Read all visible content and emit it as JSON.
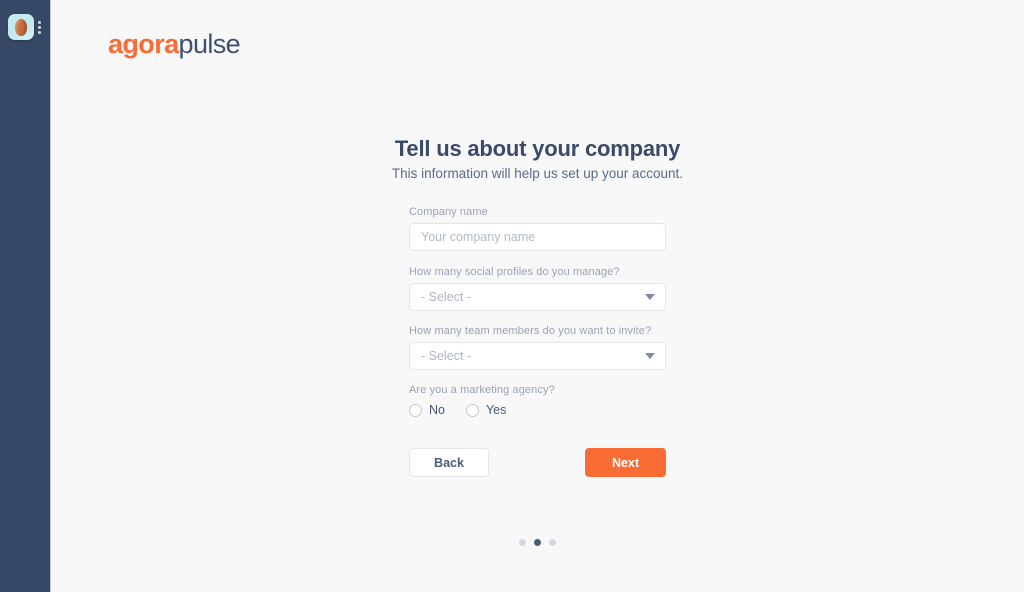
{
  "browser_sidebar": {
    "app_tile_icon": "extension-app-icon",
    "kebab_icon": "kebab-menu-icon"
  },
  "brand": {
    "logo_part_one": "agora",
    "logo_part_two": "pulse",
    "orange": "#f96c33",
    "navy": "#3f5170"
  },
  "page": {
    "headline": "Tell us about your company",
    "subhead": "This information will help us set up your account."
  },
  "form": {
    "company_name": {
      "label": "Company name",
      "placeholder": "Your company name",
      "value": ""
    },
    "social_profiles": {
      "label": "How many social profiles do you manage?",
      "selected": "- Select -",
      "caret_icon": "chevron-down-icon"
    },
    "team_members": {
      "label": "How many team members do you want to invite?",
      "selected": "- Select -",
      "caret_icon": "chevron-down-icon"
    },
    "marketing_agency": {
      "label": "Are you a marketing agency?",
      "options": [
        {
          "label": "No",
          "checked": false
        },
        {
          "label": "Yes",
          "checked": false
        }
      ]
    },
    "buttons": {
      "back": "Back",
      "next": "Next"
    }
  },
  "pager": {
    "total": 3,
    "active_index": 1
  }
}
